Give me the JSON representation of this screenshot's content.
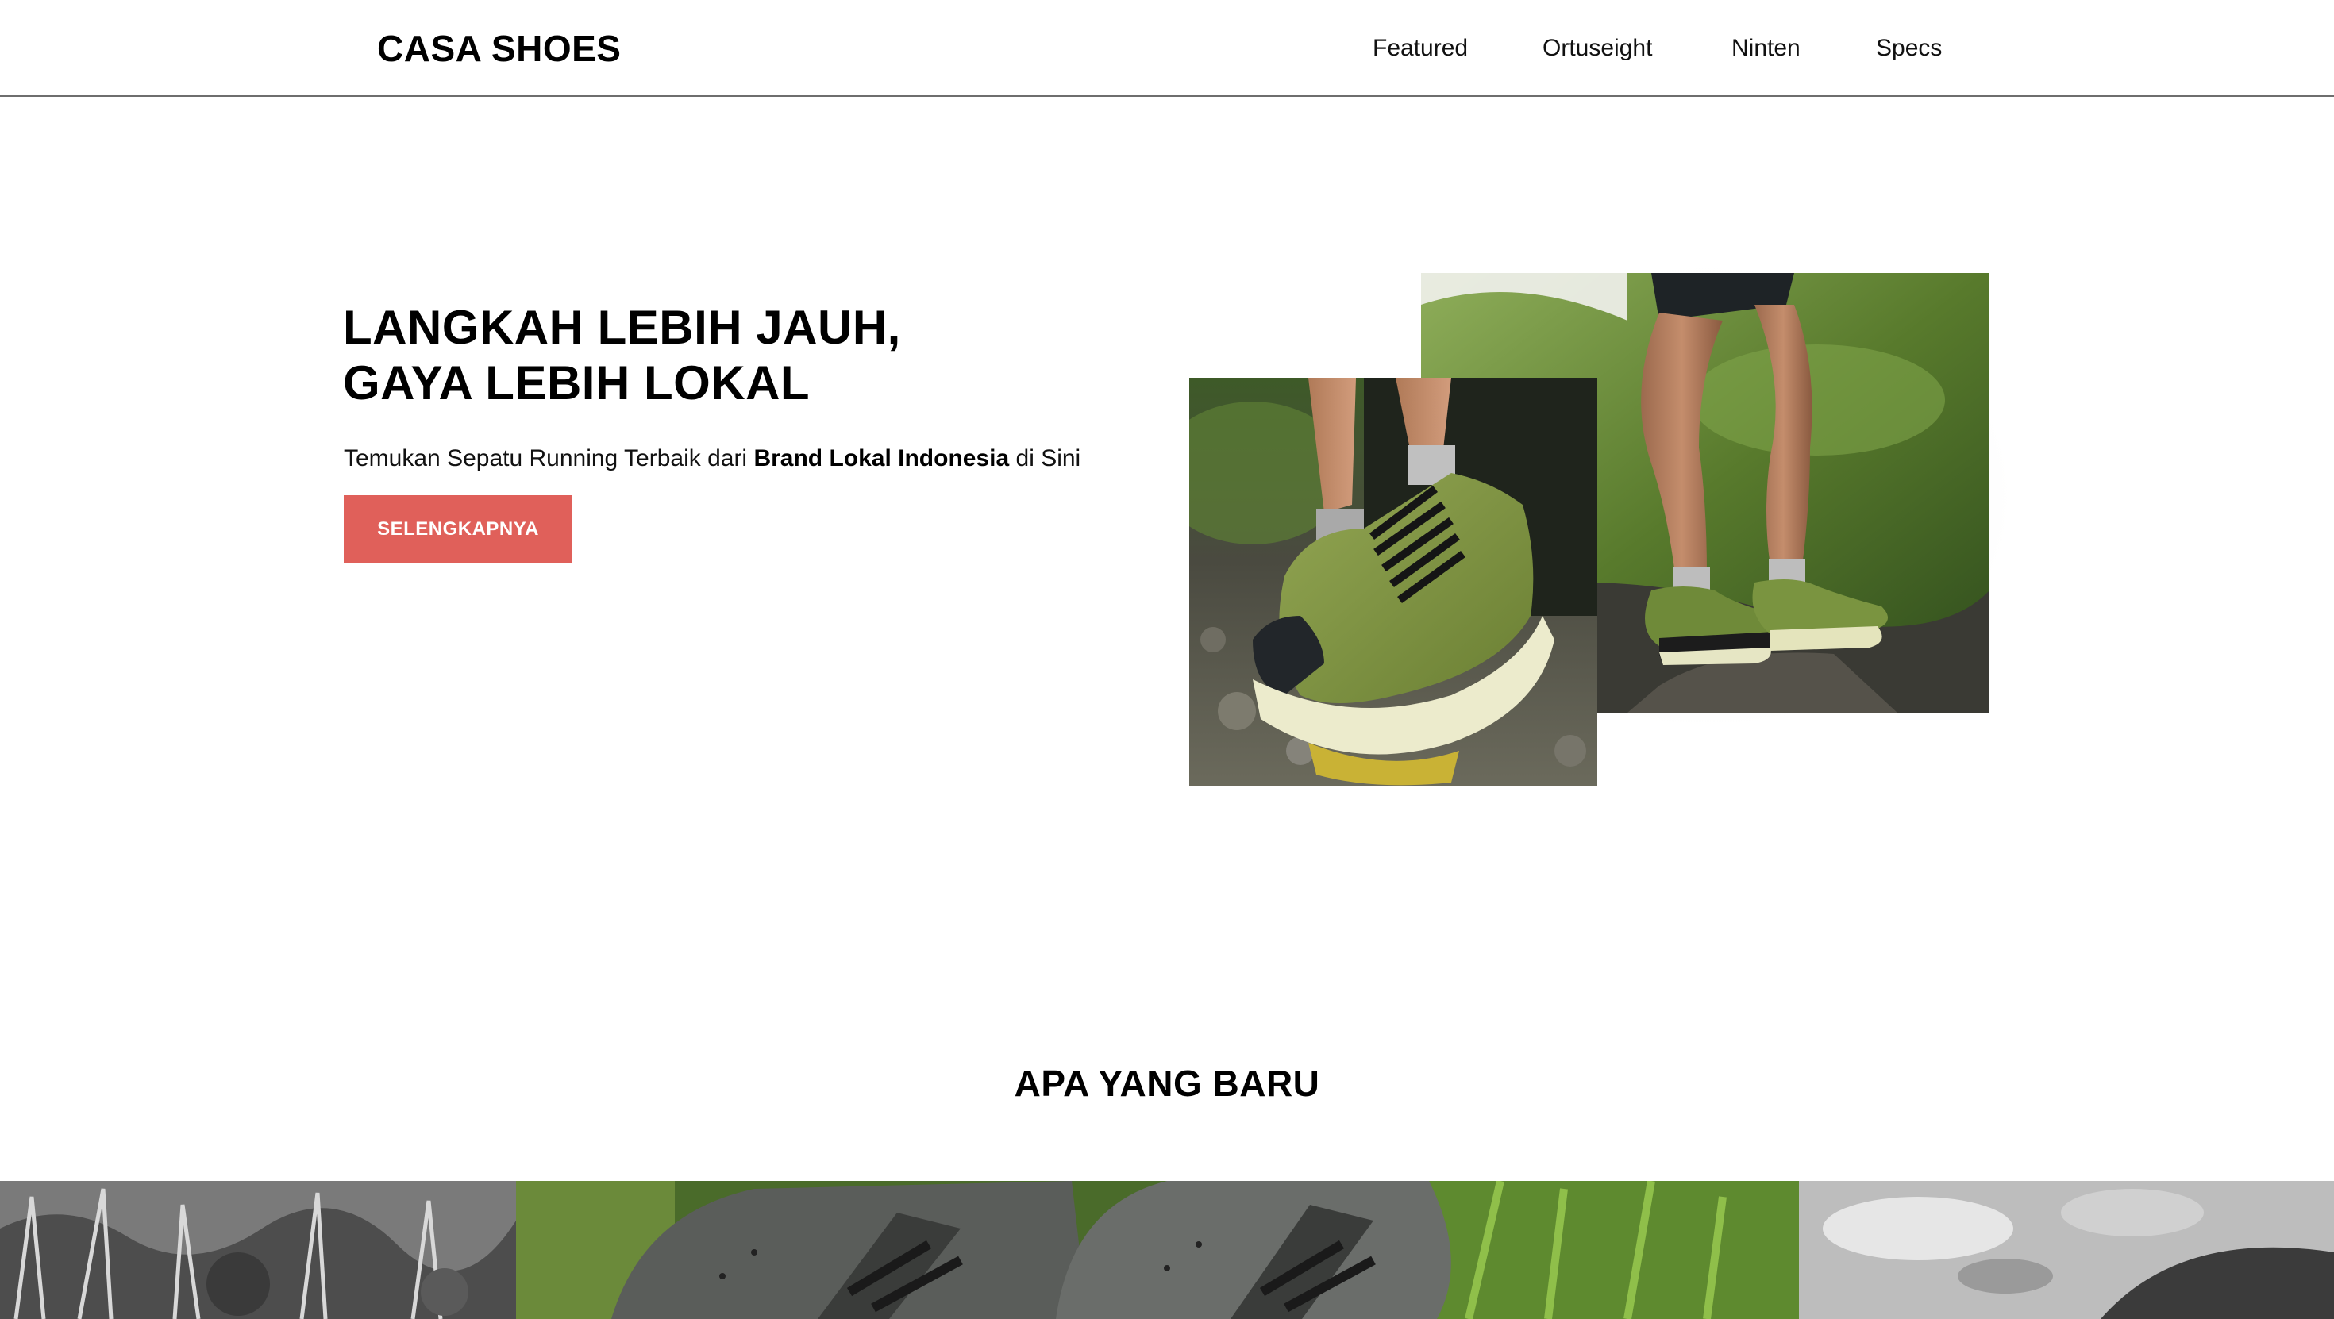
{
  "header": {
    "brand": "CASA SHOES",
    "nav": [
      {
        "label": "Featured"
      },
      {
        "label": "Ortuseight"
      },
      {
        "label": "Ninten"
      },
      {
        "label": "Specs"
      }
    ]
  },
  "hero": {
    "title_line1": "LANGKAH LEBIH JAUH,",
    "title_line2": "GAYA LEBIH LOKAL",
    "subtitle_before": "Temukan Sepatu Running Terbaik dari ",
    "subtitle_bold": "Brand Lokal Indonesia",
    "subtitle_after": " di Sini",
    "cta_label": "SELENGKAPNYA",
    "images": [
      {
        "name": "trail-runner-legs-photo",
        "alt": ""
      },
      {
        "name": "green-trail-shoe-closeup-photo",
        "alt": ""
      }
    ]
  },
  "new_section": {
    "title": "APA YANG BARU"
  },
  "colors": {
    "accent": "#e0605a",
    "text": "#000000",
    "divider": "#6e6e6e",
    "shoe_green": "#7a8c3e",
    "sole_cream": "#e8e8c8"
  }
}
